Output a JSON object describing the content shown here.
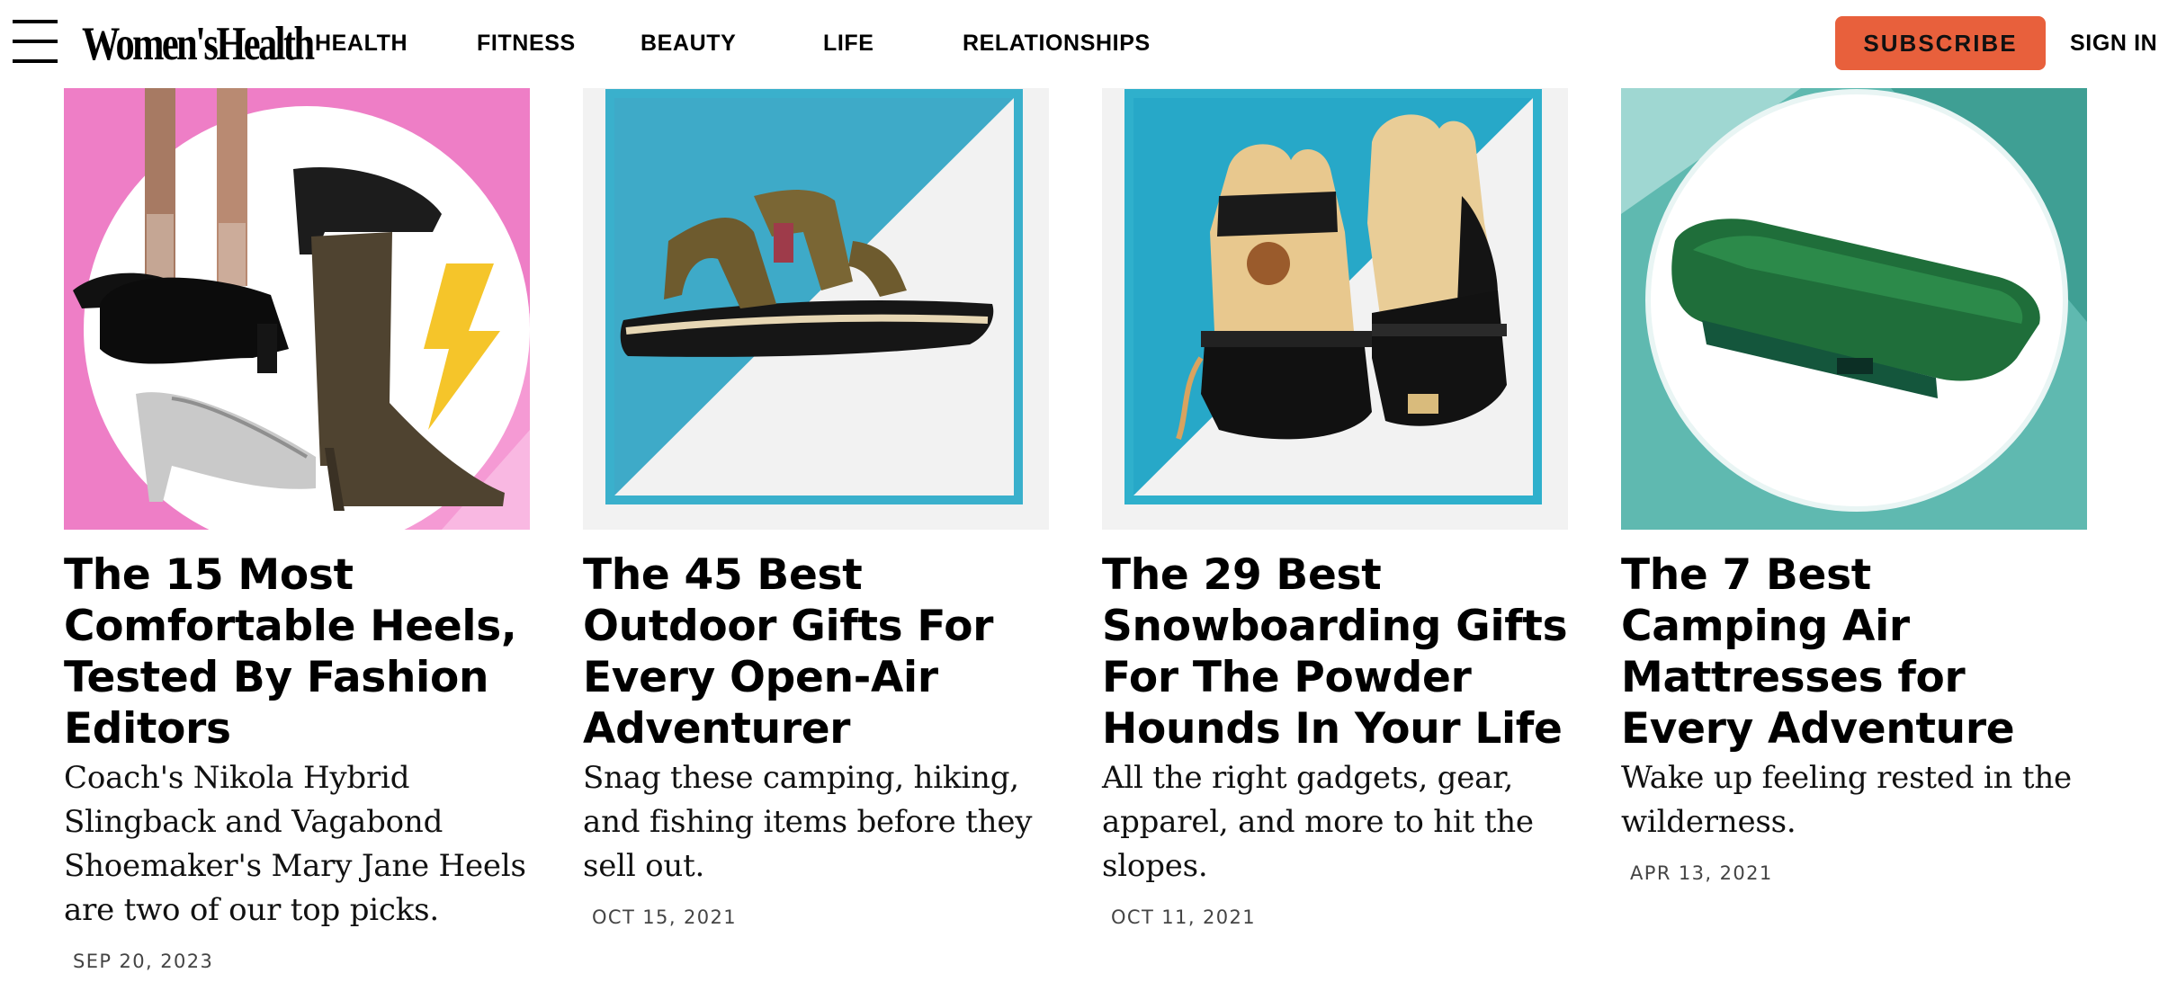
{
  "header": {
    "logo": "Women'sHealth",
    "nav": [
      "HEALTH",
      "FITNESS",
      "BEAUTY",
      "LIFE",
      "RELATIONSHIPS"
    ],
    "subscribe_label": "SUBSCRIBE",
    "signin_label": "SIGN IN",
    "accent_color": "#e8603c"
  },
  "articles": [
    {
      "title": "The 15 Most Comfortable Heels, Tested By Fashion Editors",
      "dek": "Coach's Nikola Hybrid Slingback and Vagabond Shoemaker's Mary Jane Heels are two of our top picks.",
      "date": "SEP 20, 2023",
      "image": "heels-collage"
    },
    {
      "title": "The 45 Best Outdoor Gifts For Every Open-Air Adventurer",
      "dek": "Snag these camping, hiking, and fishing items before they sell out.",
      "date": "OCT 15, 2021",
      "image": "sandal-product"
    },
    {
      "title": "The 29 Best Snowboarding Gifts For The Powder Hounds In Your Life",
      "dek": "All the right gadgets, gear, apparel, and more to hit the slopes.",
      "date": "OCT 11, 2021",
      "image": "ski-mittens-product"
    },
    {
      "title": "The 7 Best Camping Air Mattresses for Every Adventure",
      "dek": "Wake up feeling rested in the wilderness.",
      "date": "APR 13, 2021",
      "image": "air-mattress-product"
    }
  ]
}
